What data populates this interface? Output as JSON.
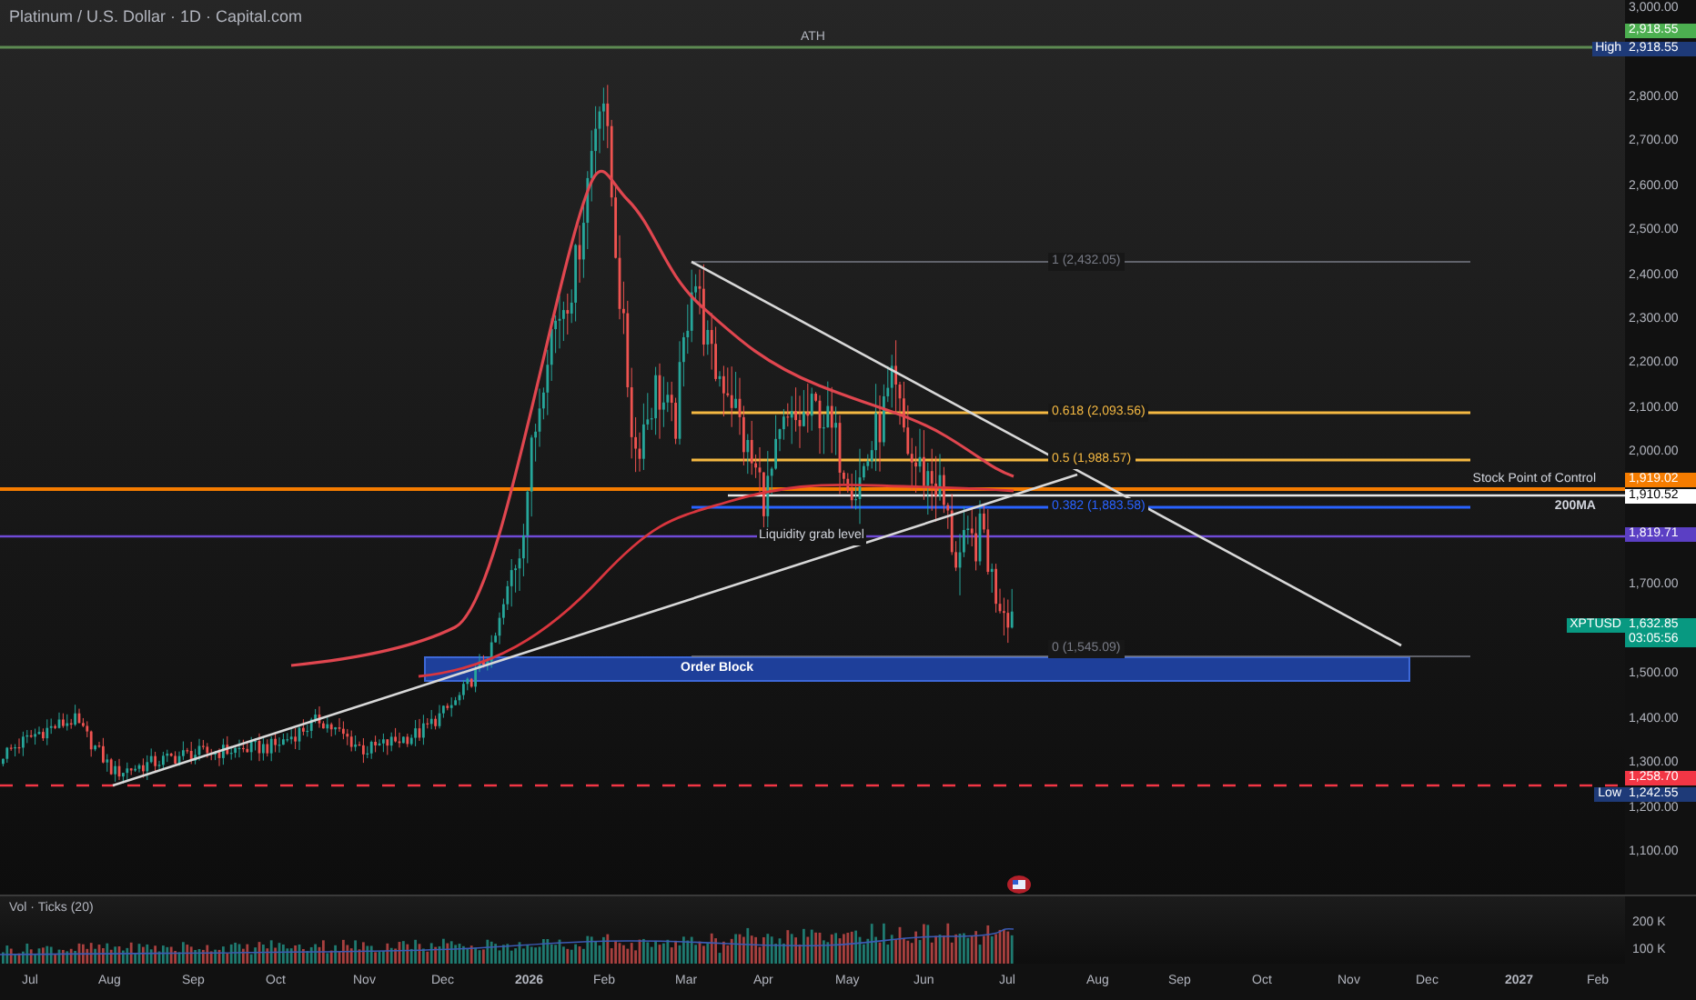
{
  "title": "Platinum / U.S. Dollar · 1D · Capital.com",
  "ath_line": {
    "label": "ATH"
  },
  "fibonacci": [
    {
      "label": "1 (2,432.05)",
      "color": "#787b86"
    },
    {
      "label": "0.618 (2,093.56)",
      "color": "#f5b942"
    },
    {
      "label": "0.5 (1,988.57)",
      "color": "#f5b942"
    },
    {
      "label": "0.382 (1,883.58)",
      "color": "#2962ff"
    },
    {
      "label": "0 (1,545.09)",
      "color": "#787b86"
    }
  ],
  "liquidity_label": "Liquidity grab level",
  "poc_label": "Stock Point of Control",
  "ma_label": "200MA",
  "order_block": {
    "label": "Order Block"
  },
  "price_axis": [
    "3,000.00",
    "2,800.00",
    "2,700.00",
    "2,600.00",
    "2,500.00",
    "2,400.00",
    "2,300.00",
    "2,200.00",
    "2,100.00",
    "2,000.00",
    "1,700.00",
    "1,500.00",
    "1,400.00",
    "1,300.00",
    "1,200.00",
    "1,100.00"
  ],
  "price_tags": [
    {
      "text": "2,918.55",
      "color": "#4caf50"
    },
    {
      "tag": "High",
      "text": "2,918.55",
      "color": "#1e3a78"
    },
    {
      "text": "1,919.02",
      "color": "#f57c00"
    },
    {
      "text": "1,910.52",
      "color": "#ffffff"
    },
    {
      "text": "1,819.71",
      "color": "#5b3fc4"
    },
    {
      "tag": "XPTUSD",
      "text": "1,632.85",
      "sub": "03:05:56",
      "color": "#089981"
    },
    {
      "text": "1,258.70",
      "color": "#f23645"
    },
    {
      "tag": "Low",
      "text": "1,242.55",
      "color": "#1e3a78"
    }
  ],
  "volume": {
    "title": "Vol · Ticks (20)",
    "axis": [
      "200 K",
      "100 K"
    ]
  },
  "time_axis": [
    {
      "label": "Jul",
      "kind": "month"
    },
    {
      "label": "Aug",
      "kind": "month"
    },
    {
      "label": "Sep",
      "kind": "month"
    },
    {
      "label": "Oct",
      "kind": "month"
    },
    {
      "label": "Nov",
      "kind": "month"
    },
    {
      "label": "Dec",
      "kind": "month"
    },
    {
      "label": "2026",
      "kind": "year"
    },
    {
      "label": "Feb",
      "kind": "month"
    },
    {
      "label": "Mar",
      "kind": "month"
    },
    {
      "label": "Apr",
      "kind": "month"
    },
    {
      "label": "May",
      "kind": "month"
    },
    {
      "label": "Jun",
      "kind": "month"
    },
    {
      "label": "Jul",
      "kind": "month"
    },
    {
      "label": "Aug",
      "kind": "month"
    },
    {
      "label": "Sep",
      "kind": "month"
    },
    {
      "label": "Oct",
      "kind": "month"
    },
    {
      "label": "Nov",
      "kind": "month"
    },
    {
      "label": "Dec",
      "kind": "month"
    },
    {
      "label": "2027",
      "kind": "year"
    },
    {
      "label": "Feb",
      "kind": "month"
    }
  ]
}
